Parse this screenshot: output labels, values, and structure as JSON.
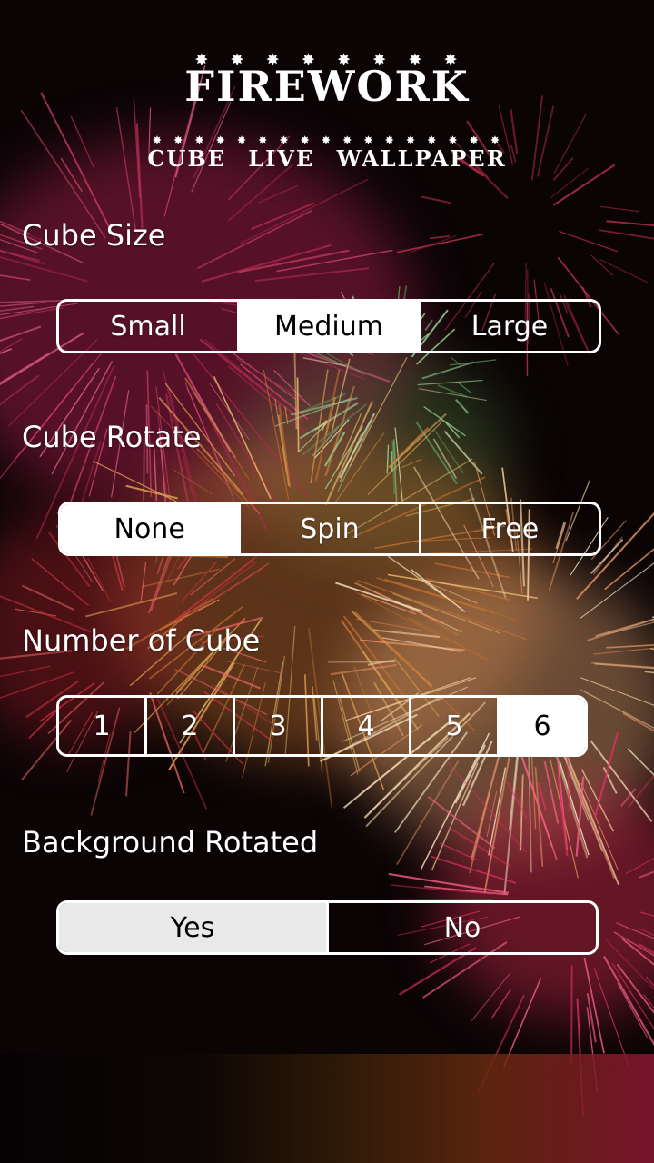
{
  "header": {
    "title": "FIREWORK",
    "subtitle": "CUBE LIVE WALLPAPER",
    "title_star_glyphs": [
      "✸",
      "✸",
      "✸",
      "✸",
      "✸",
      "✸",
      "✸",
      "✸"
    ],
    "subtitle_star_glyphs": [
      "✸",
      "✸",
      "✸",
      "✸",
      "✸",
      "✸",
      "✸",
      "✸",
      "✸",
      "✸",
      "✸",
      "✸",
      "✸",
      "✸",
      "✸",
      "✸",
      "✸"
    ]
  },
  "settings": {
    "cube_size": {
      "label": "Cube Size",
      "options": [
        "Small",
        "Medium",
        "Large"
      ],
      "selected": "Medium"
    },
    "cube_rotate": {
      "label": "Cube Rotate",
      "options": [
        "None",
        "Spin",
        "Free"
      ],
      "selected": "None"
    },
    "number_of_cube": {
      "label": "Number of Cube",
      "options": [
        "1",
        "2",
        "3",
        "4",
        "5",
        "6"
      ],
      "selected": "6"
    },
    "background_rotated": {
      "label": "Background Rotated",
      "options": [
        "Yes",
        "No"
      ],
      "selected": "Yes"
    }
  },
  "colors": {
    "selected_bg": "#ffffff",
    "selected_bg_alt": "#e9e9e9",
    "border": "#ffffff",
    "text": "#ffffff",
    "selected_text": "#000000"
  }
}
